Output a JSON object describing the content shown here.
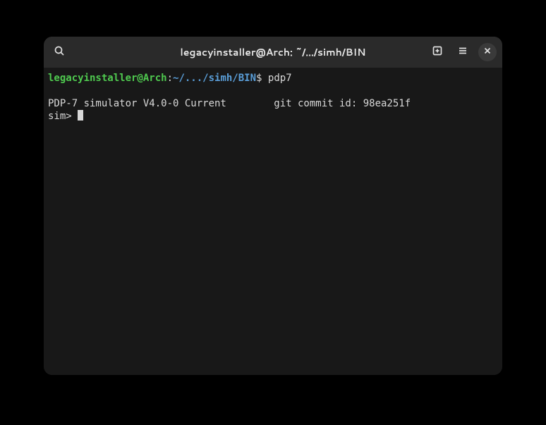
{
  "titlebar": {
    "title": "legacyinstaller@Arch: ~/.../simh/BIN"
  },
  "prompt": {
    "user_host": "legacyinstaller@Arch",
    "colon": ":",
    "path": "~/.../simh/BIN",
    "dollar": "$ ",
    "command": "pdp7"
  },
  "output": {
    "line1": "PDP-7 simulator V4.0-0 Current        git commit id: 98ea251f"
  },
  "sim_prompt": "sim> "
}
